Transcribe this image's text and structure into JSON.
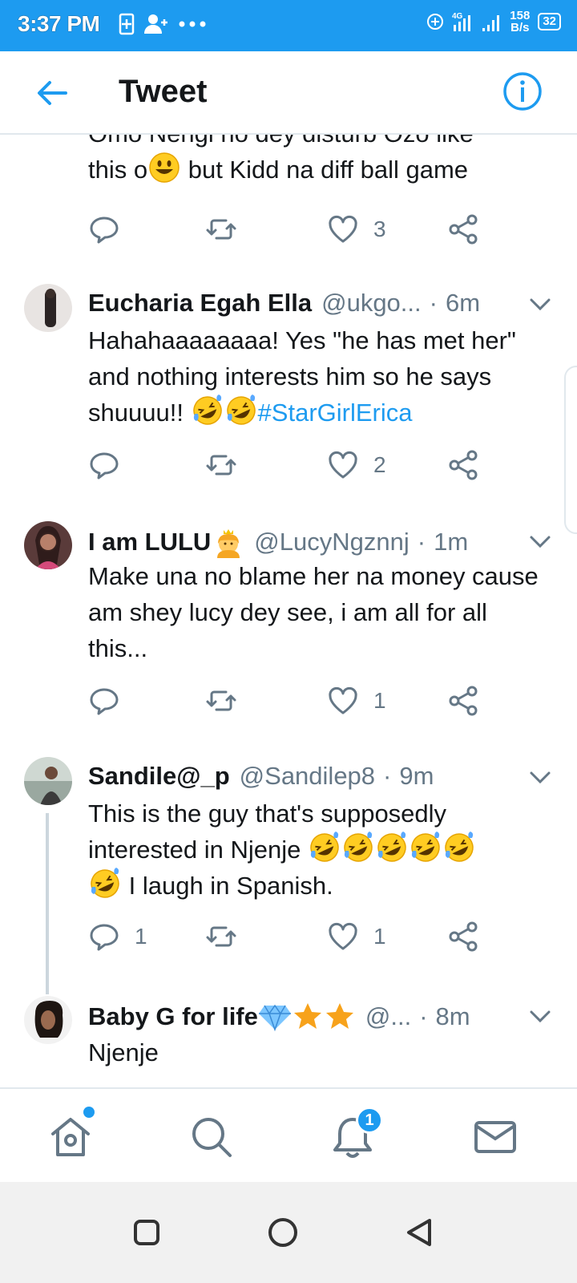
{
  "status_bar": {
    "time": "3:37 PM",
    "network": "4G",
    "speed_value": "158",
    "speed_unit": "B/s",
    "battery": "32"
  },
  "header": {
    "title": "Tweet",
    "back_icon": "arrow-left-icon",
    "info_icon": "info-icon"
  },
  "colors": {
    "brand": "#1d9bf0",
    "secondary_text": "#657786",
    "primary_text": "#14171a"
  },
  "tweets": [
    {
      "partial_text_line1": "Omo Nengi no dey disturb Ozo like",
      "text_before_emoji": "this o",
      "text_after_emoji": " but Kidd na diff ball game",
      "reply_count": "",
      "retweet_count": "",
      "like_count": "3"
    },
    {
      "name": "Eucharia Egah Ella",
      "handle": "@ukgo...",
      "separator": "·",
      "time": "6m",
      "text": "Hahahaaaaaaaa! Yes \"he has met her\" and nothing interests him so he says shuuuu!! ",
      "hashtag": "#StarGirlErica",
      "reply_count": "",
      "retweet_count": "",
      "like_count": "2"
    },
    {
      "name": "I am LULU",
      "handle": "@LucyNgznnj",
      "separator": "·",
      "time": "1m",
      "text": "Make una no blame her na money cause am shey lucy dey see, i am all for all this...",
      "reply_count": "",
      "retweet_count": "",
      "like_count": "1"
    },
    {
      "name": "Sandile@_p",
      "handle": "@Sandilep8",
      "separator": "·",
      "time": "9m",
      "text_line1": "This is the guy that's supposedly",
      "text_line2": "interested in Njenje ",
      "text_line3": " I laugh in Spanish.",
      "reply_count": "1",
      "retweet_count": "",
      "like_count": "1"
    },
    {
      "name": "Baby G for life",
      "handle": "@...",
      "separator": "·",
      "time": "8m",
      "text": "Njenje"
    }
  ],
  "bottom_nav": {
    "items": [
      "home-icon",
      "search-icon",
      "notifications-icon",
      "messages-icon"
    ],
    "notification_badge": "1"
  },
  "system_nav": [
    "recents-button",
    "home-button",
    "back-button"
  ]
}
